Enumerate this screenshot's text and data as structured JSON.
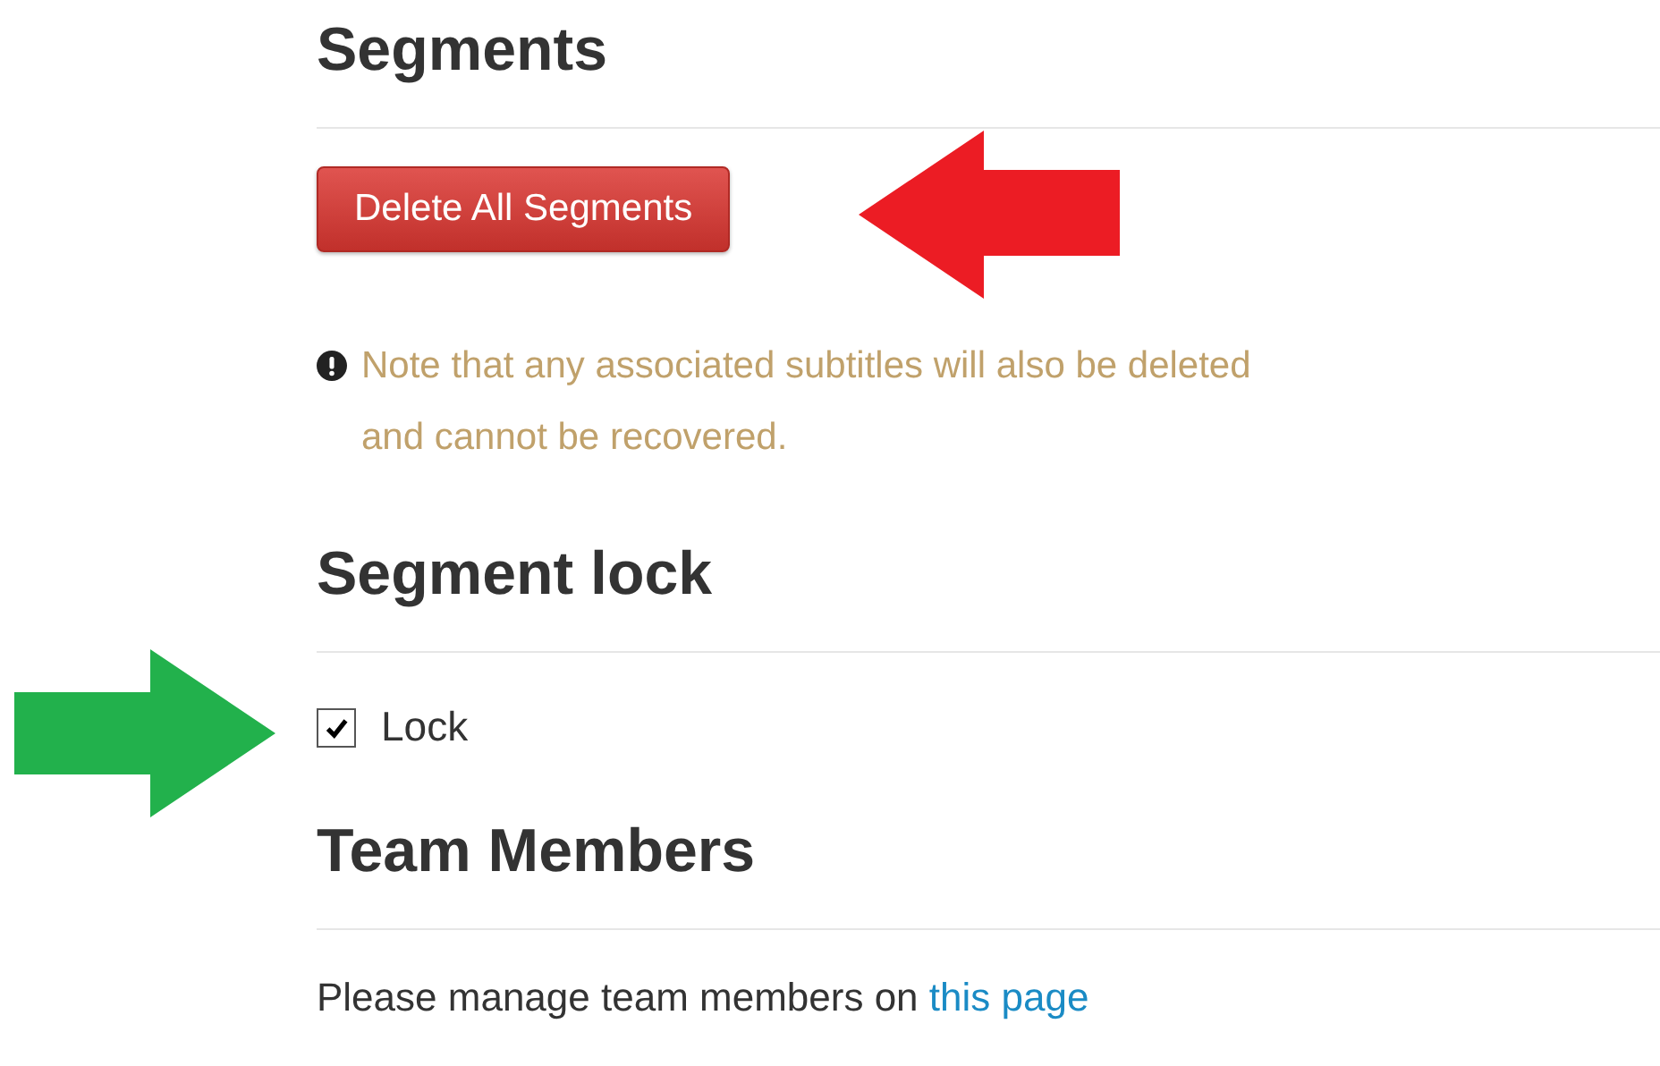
{
  "segments": {
    "heading": "Segments",
    "delete_button": "Delete All Segments",
    "note": "Note that any associated subtitles will also be deleted and cannot be recovered."
  },
  "segment_lock": {
    "heading": "Segment lock",
    "checkbox": {
      "label": "Lock",
      "checked": true
    }
  },
  "team_members": {
    "heading": "Team Members",
    "text": "Please manage team members on",
    "link": "this page"
  }
}
